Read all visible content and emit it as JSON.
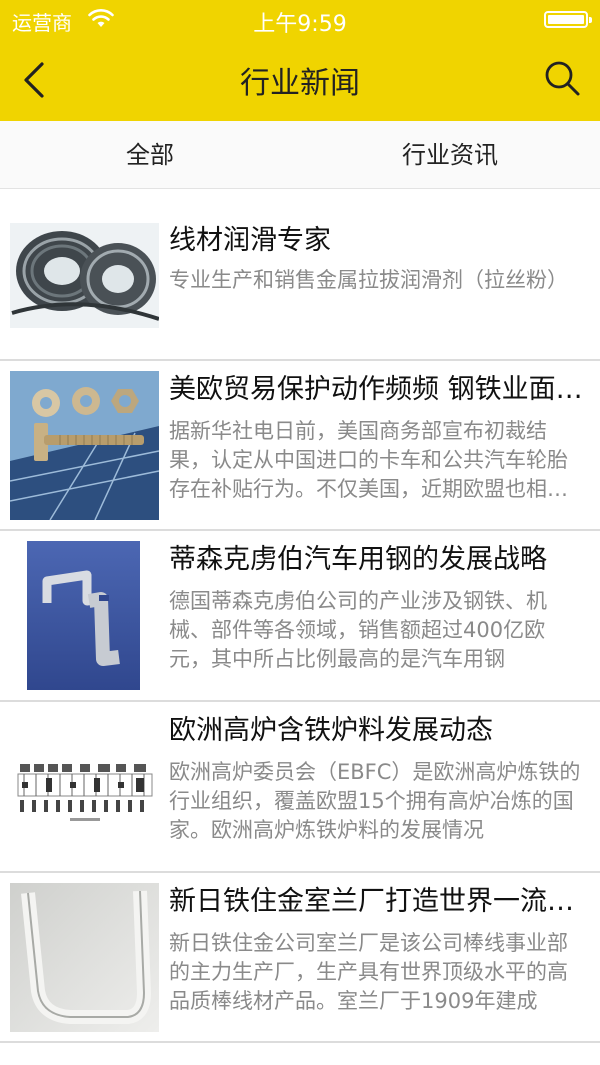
{
  "status_bar": {
    "carrier": "运营商",
    "time": "上午9:59",
    "battery_level": 1.0
  },
  "nav": {
    "title": "行业新闻",
    "back_icon": "chevron-left-icon",
    "search_icon": "search-icon"
  },
  "tabs": [
    {
      "label": "全部"
    },
    {
      "label": "行业资讯"
    }
  ],
  "colors": {
    "accent": "#f0d400",
    "title_text": "#111111",
    "desc_text": "#8a8a8a"
  },
  "articles": [
    {
      "title": "线材润滑专家",
      "summary": "专业生产和销售金属拉拔润滑剂（拉丝粉）",
      "thumbnail": "wire-coil-image"
    },
    {
      "title": "美欧贸易保护动作频频 钢铁业面临挑战",
      "summary": "据新华社电日前，美国商务部宣布初裁结果，认定从中国进口的卡车和公共汽车轮胎存在补贴行为。不仅美国，近期欧盟也相继出台措施",
      "thumbnail": "bolts-and-nuts-image"
    },
    {
      "title": "蒂森克虏伯汽车用钢的发展战略",
      "summary": "德国蒂森克虏伯公司的产业涉及钢铁、机械、部件等各领域，销售额超过400亿欧元，其中所占比例最高的是汽车用钢",
      "thumbnail": "metal-bracket-image"
    },
    {
      "title": "欧洲高炉含铁炉料发展动态",
      "summary": "欧洲高炉委员会（EBFC）是欧洲高炉炼铁的行业组织，覆盖欧盟15个拥有高炉冶炼的国家。欧洲高炉炼铁炉料的发展情况",
      "thumbnail": "furnace-diagram-image"
    },
    {
      "title": "新日铁住金室兰厂打造世界一流棒线厂",
      "summary": "新日铁住金公司室兰厂是该公司棒线事业部的主力生产厂，生产具有世界顶级水平的高品质棒线材产品。室兰厂于1909年建成",
      "thumbnail": "u-bracket-image"
    }
  ]
}
